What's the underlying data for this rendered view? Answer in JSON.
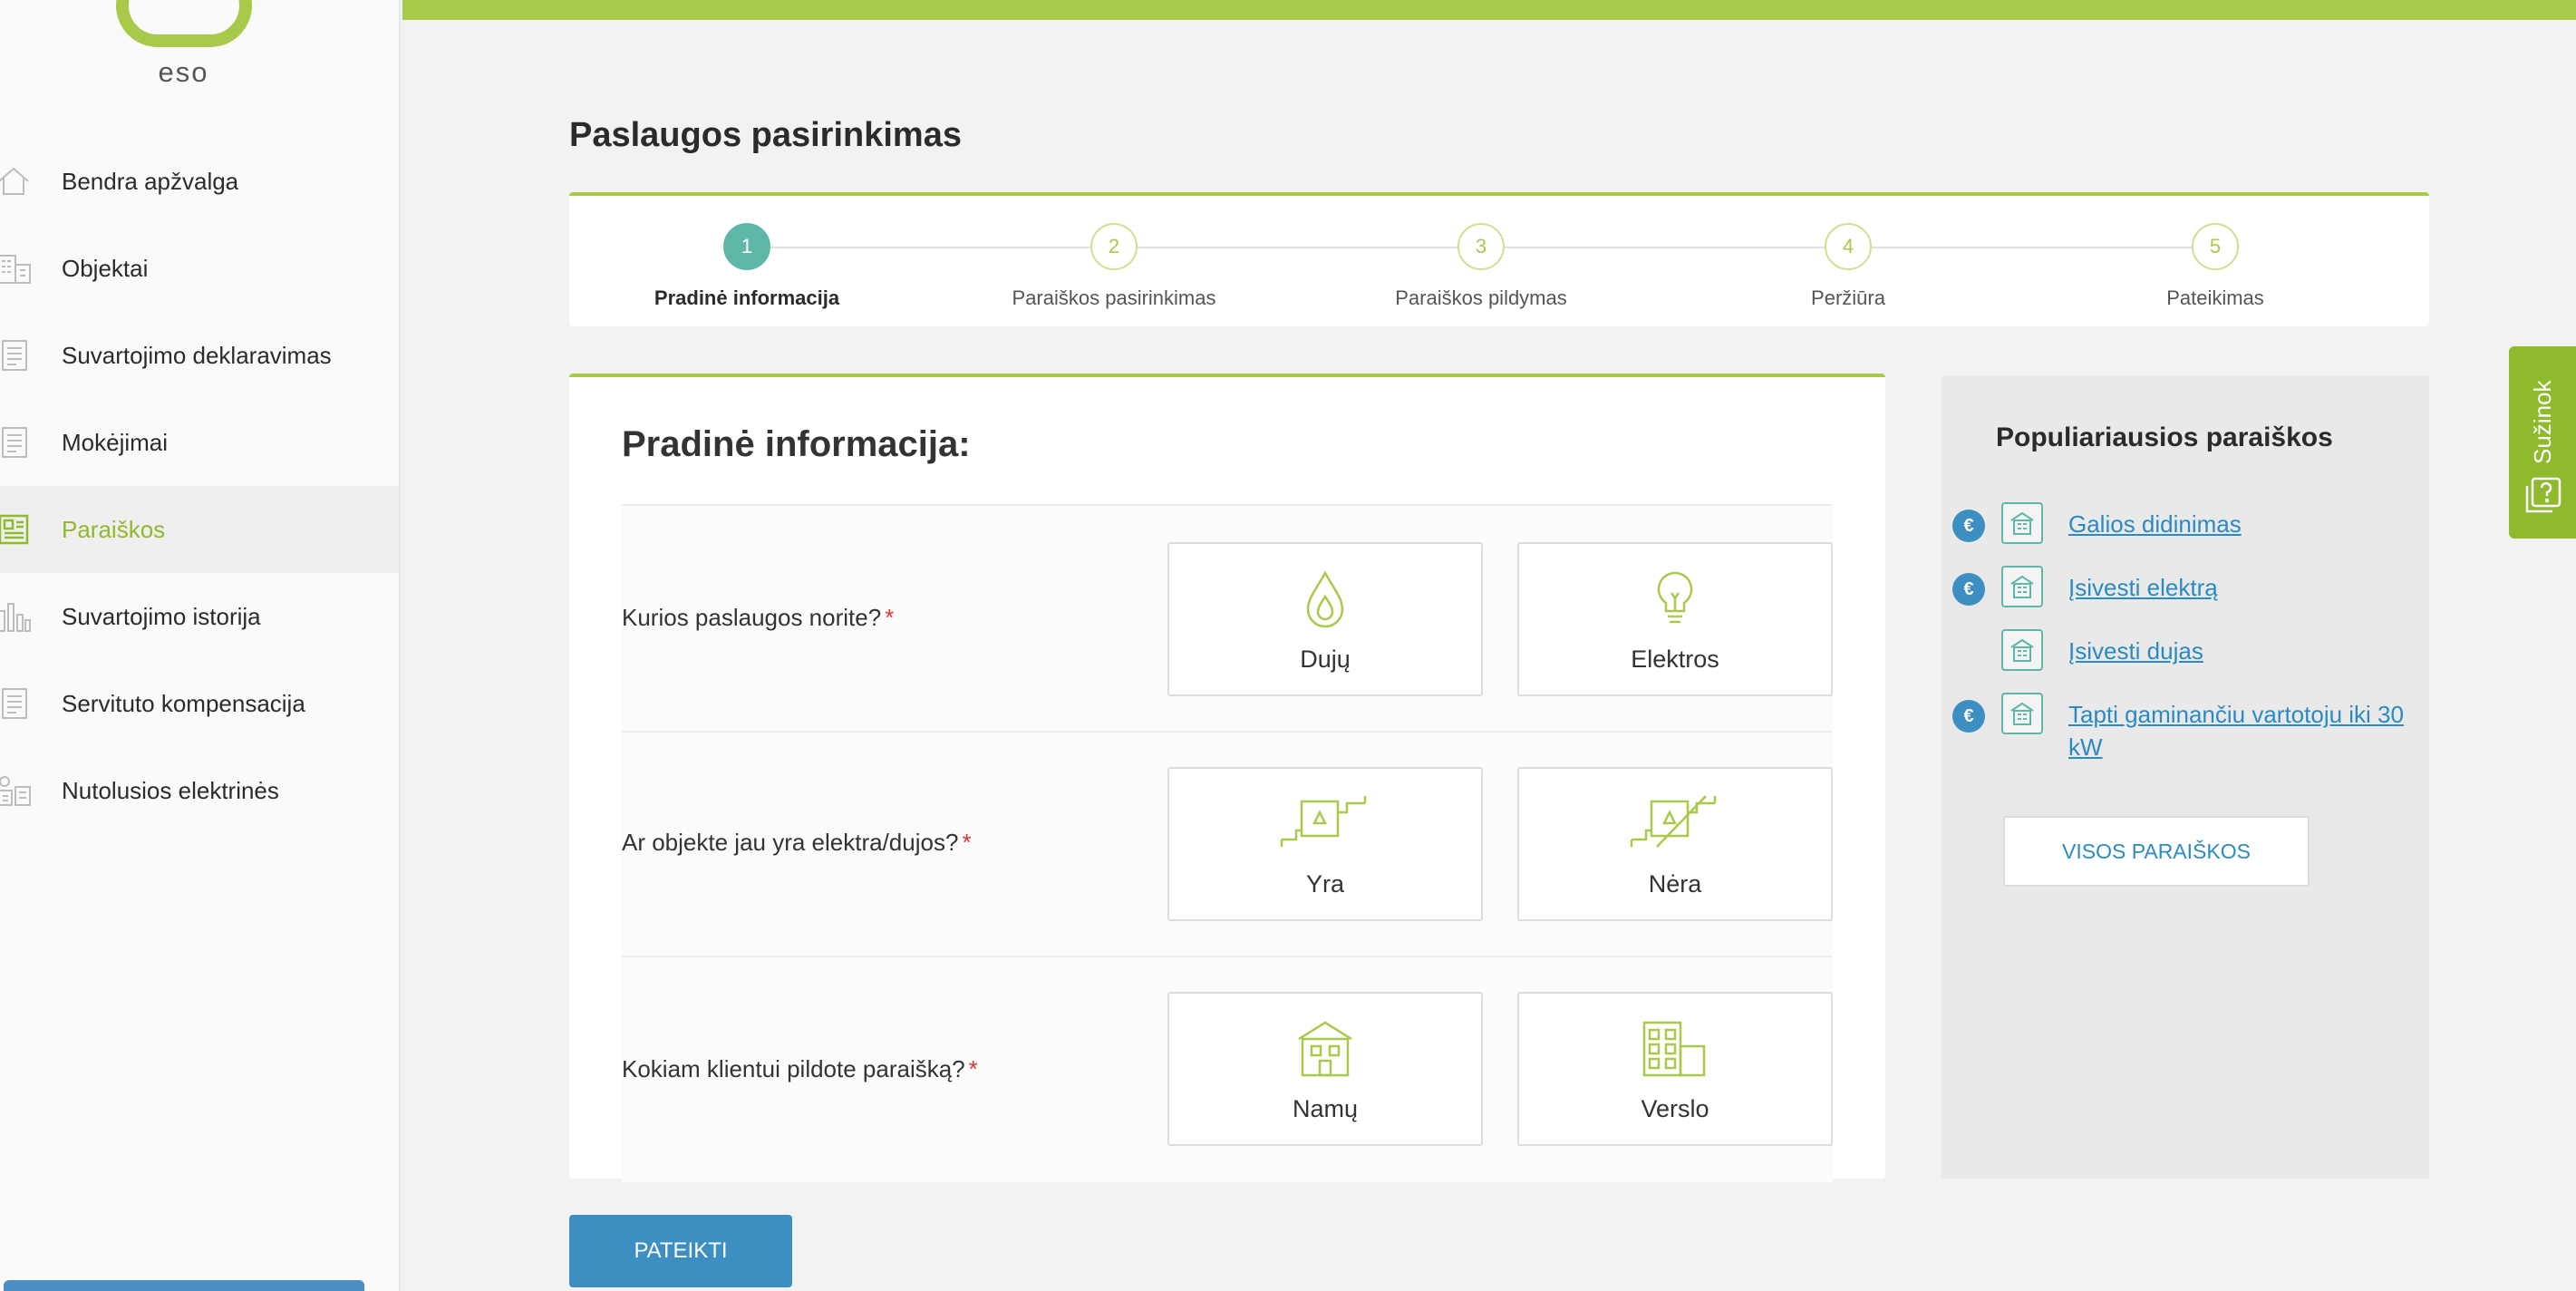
{
  "logo": {
    "text": "eso"
  },
  "sidebar": {
    "items": [
      {
        "label": "Bendra apžvalga",
        "icon": "home-icon"
      },
      {
        "label": "Objektai",
        "icon": "buildings-icon"
      },
      {
        "label": "Suvartojimo deklaravimas",
        "icon": "document-icon"
      },
      {
        "label": "Mokėjimai",
        "icon": "document-icon"
      },
      {
        "label": "Paraiškos",
        "icon": "form-icon",
        "active": true
      },
      {
        "label": "Suvartojimo istorija",
        "icon": "bar-chart-icon"
      },
      {
        "label": "Servituto kompensacija",
        "icon": "document-icon"
      },
      {
        "label": "Nutolusios elektrinės",
        "icon": "solar-plant-icon"
      }
    ]
  },
  "main": {
    "title": "Paslaugos pasirinkimas",
    "steps": [
      {
        "number": "1",
        "label": "Pradinė informacija",
        "active": true
      },
      {
        "number": "2",
        "label": "Paraiškos pasirinkimas"
      },
      {
        "number": "3",
        "label": "Paraiškos pildymas"
      },
      {
        "number": "4",
        "label": "Peržiūra"
      },
      {
        "number": "5",
        "label": "Pateikimas"
      }
    ],
    "form": {
      "title": "Pradinė informacija:",
      "required_mark": "*",
      "questions": [
        {
          "label": "Kurios paslaugos norite?",
          "options": [
            "Dujų",
            "Elektros"
          ]
        },
        {
          "label": "Ar objekte jau yra elektra/dujos?",
          "options": [
            "Yra",
            "Nėra"
          ]
        },
        {
          "label": "Kokiam klientui pildote paraišką?",
          "options": [
            "Namų",
            "Verslo"
          ]
        }
      ]
    },
    "submit_label": "PATEIKTI"
  },
  "popular": {
    "title": "Populiariausios paraiškos",
    "items": [
      {
        "label": "Galios didinimas",
        "paid": true
      },
      {
        "label": "Įsivesti elektrą",
        "paid": true
      },
      {
        "label": "Įsivesti dujas",
        "paid": false
      },
      {
        "label": "Tapti gaminančiu vartotoju iki 30 kW",
        "paid": true
      }
    ],
    "euro_symbol": "€",
    "all_button": "VISOS PARAIŠKOS"
  },
  "learn_tab": {
    "label": "Sužinok"
  },
  "colors": {
    "accent_green": "#a8c94a",
    "active_step": "#5fb7a8",
    "primary_blue": "#3d8fc2",
    "link_blue": "#2a8bc4"
  }
}
